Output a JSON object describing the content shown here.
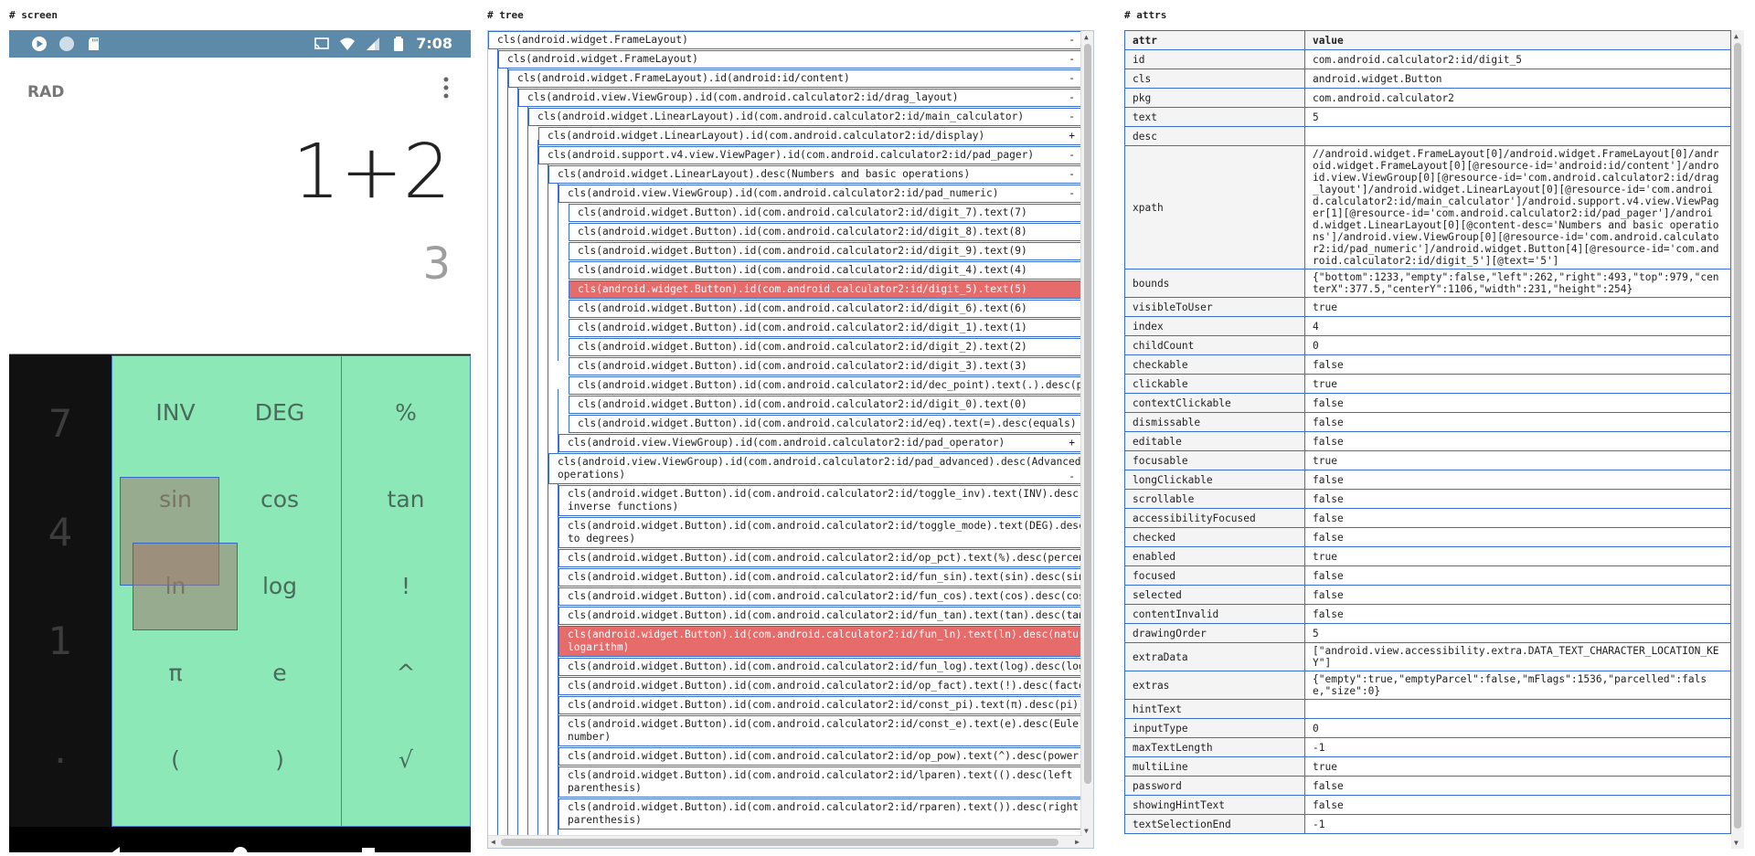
{
  "sections": {
    "screen": "# screen",
    "tree": "# tree",
    "attrs": "# attrs"
  },
  "phone": {
    "status": {
      "time": "7:08"
    },
    "display": {
      "mode": "RAD",
      "formula": "1+2",
      "result": "3"
    },
    "numeric_keys": [
      "7",
      "4",
      "1",
      "."
    ],
    "advanced_keys": [
      "INV",
      "DEG",
      "%",
      "sin",
      "cos",
      "tan",
      "ln",
      "log",
      "!",
      "π",
      "e",
      "^",
      "(",
      ")",
      "√"
    ],
    "colors": {
      "status_bar": "#5d8aa8",
      "advanced_pad": "#8de8b7",
      "numeric_pad": "#111111",
      "highlight": "#e66b6b"
    }
  },
  "tree": {
    "rows": [
      {
        "text": "cls(android.widget.FrameLayout)",
        "toggle": "-"
      },
      {
        "text": "cls(android.widget.FrameLayout)",
        "toggle": "-"
      },
      {
        "text": "cls(android.widget.FrameLayout).id(android:id/content)",
        "toggle": "-"
      },
      {
        "text": "cls(android.view.ViewGroup).id(com.android.calculator2:id/drag_layout)",
        "toggle": "-"
      },
      {
        "text": "cls(android.widget.LinearLayout).id(com.android.calculator2:id/main_calculator)",
        "toggle": "-"
      },
      {
        "text": "cls(android.widget.LinearLayout).id(com.android.calculator2:id/display)",
        "toggle": "+"
      },
      {
        "text": "cls(android.support.v4.view.ViewPager).id(com.android.calculator2:id/pad_pager)",
        "toggle": "-"
      },
      {
        "text": "cls(android.widget.LinearLayout).desc(Numbers and basic operations)",
        "toggle": "-"
      },
      {
        "text": "cls(android.view.ViewGroup).id(com.android.calculator2:id/pad_numeric)",
        "toggle": "-"
      },
      {
        "text": "cls(android.widget.Button).id(com.android.calculator2:id/digit_7).text(7)",
        "toggle": ""
      },
      {
        "text": "cls(android.widget.Button).id(com.android.calculator2:id/digit_8).text(8)",
        "toggle": ""
      },
      {
        "text": "cls(android.widget.Button).id(com.android.calculator2:id/digit_9).text(9)",
        "toggle": ""
      },
      {
        "text": "cls(android.widget.Button).id(com.android.calculator2:id/digit_4).text(4)",
        "toggle": ""
      },
      {
        "text": "cls(android.widget.Button).id(com.android.calculator2:id/digit_5).text(5)",
        "toggle": ""
      },
      {
        "text": "cls(android.widget.Button).id(com.android.calculator2:id/digit_6).text(6)",
        "toggle": ""
      },
      {
        "text": "cls(android.widget.Button).id(com.android.calculator2:id/digit_1).text(1)",
        "toggle": ""
      },
      {
        "text": "cls(android.widget.Button).id(com.android.calculator2:id/digit_2).text(2)",
        "toggle": ""
      },
      {
        "text": "cls(android.widget.Button).id(com.android.calculator2:id/digit_3).text(3)",
        "toggle": ""
      },
      {
        "text": "cls(android.widget.Button).id(com.android.calculator2:id/dec_point).text(.).desc(point)",
        "toggle": ""
      },
      {
        "text": "cls(android.widget.Button).id(com.android.calculator2:id/digit_0).text(0)",
        "toggle": ""
      },
      {
        "text": "cls(android.widget.Button).id(com.android.calculator2:id/eq).text(=).desc(equals)",
        "toggle": ""
      },
      {
        "text": "cls(android.view.ViewGroup).id(com.android.calculator2:id/pad_operator)",
        "toggle": "+"
      },
      {
        "text": "cls(android.view.ViewGroup).id(com.android.calculator2:id/pad_advanced).desc(Advanced operations)",
        "toggle": "-"
      },
      {
        "text": "cls(android.widget.Button).id(com.android.calculator2:id/toggle_inv).text(INV).desc(show inverse functions)",
        "toggle": ""
      },
      {
        "text": "cls(android.widget.Button).id(com.android.calculator2:id/toggle_mode).text(DEG).desc(switch to degrees)",
        "toggle": ""
      },
      {
        "text": "cls(android.widget.Button).id(com.android.calculator2:id/op_pct).text(%).desc(percent)",
        "toggle": ""
      },
      {
        "text": "cls(android.widget.Button).id(com.android.calculator2:id/fun_sin).text(sin).desc(sine)",
        "toggle": ""
      },
      {
        "text": "cls(android.widget.Button).id(com.android.calculator2:id/fun_cos).text(cos).desc(cosine)",
        "toggle": ""
      },
      {
        "text": "cls(android.widget.Button).id(com.android.calculator2:id/fun_tan).text(tan).desc(tangent)",
        "toggle": ""
      },
      {
        "text": "cls(android.widget.Button).id(com.android.calculator2:id/fun_ln).text(ln).desc(natural logarithm)",
        "toggle": ""
      },
      {
        "text": "cls(android.widget.Button).id(com.android.calculator2:id/fun_log).text(log).desc(logarithm)",
        "toggle": ""
      },
      {
        "text": "cls(android.widget.Button).id(com.android.calculator2:id/op_fact).text(!).desc(factorial)",
        "toggle": ""
      },
      {
        "text": "cls(android.widget.Button).id(com.android.calculator2:id/const_pi).text(π).desc(pi)",
        "toggle": ""
      },
      {
        "text": "cls(android.widget.Button).id(com.android.calculator2:id/const_e).text(e).desc(Euler's number)",
        "toggle": ""
      },
      {
        "text": "cls(android.widget.Button).id(com.android.calculator2:id/op_pow).text(^).desc(power)",
        "toggle": ""
      },
      {
        "text": "cls(android.widget.Button).id(com.android.calculator2:id/lparen).text(().desc(left parenthesis)",
        "toggle": ""
      },
      {
        "text": "cls(android.widget.Button).id(com.android.calculator2:id/rparen).text()).desc(right parenthesis)",
        "toggle": ""
      }
    ]
  },
  "attrs": {
    "header": [
      "attr",
      "value"
    ],
    "rows": [
      [
        "id",
        "com.android.calculator2:id/digit_5"
      ],
      [
        "cls",
        "android.widget.Button"
      ],
      [
        "pkg",
        "com.android.calculator2"
      ],
      [
        "text",
        "5"
      ],
      [
        "desc",
        ""
      ],
      [
        "xpath",
        "//android.widget.FrameLayout[0]/android.widget.FrameLayout[0]/android.widget.FrameLayout[0][@resource-id='android:id/content']/android.view.ViewGroup[0][@resource-id='com.android.calculator2:id/drag_layout']/android.widget.LinearLayout[0][@resource-id='com.android.calculator2:id/main_calculator']/android.support.v4.view.ViewPager[1][@resource-id='com.android.calculator2:id/pad_pager']/android.widget.LinearLayout[0][@content-desc='Numbers and basic operations']/android.view.ViewGroup[0][@resource-id='com.android.calculator2:id/pad_numeric']/android.widget.Button[4][@resource-id='com.android.calculator2:id/digit_5'][@text='5']"
      ],
      [
        "bounds",
        "{\"bottom\":1233,\"empty\":false,\"left\":262,\"right\":493,\"top\":979,\"centerX\":377.5,\"centerY\":1106,\"width\":231,\"height\":254}"
      ],
      [
        "visibleToUser",
        "true"
      ],
      [
        "index",
        "4"
      ],
      [
        "childCount",
        "0"
      ],
      [
        "checkable",
        "false"
      ],
      [
        "clickable",
        "true"
      ],
      [
        "contextClickable",
        "false"
      ],
      [
        "dismissable",
        "false"
      ],
      [
        "editable",
        "false"
      ],
      [
        "focusable",
        "true"
      ],
      [
        "longClickable",
        "false"
      ],
      [
        "scrollable",
        "false"
      ],
      [
        "accessibilityFocused",
        "false"
      ],
      [
        "checked",
        "false"
      ],
      [
        "enabled",
        "true"
      ],
      [
        "focused",
        "false"
      ],
      [
        "selected",
        "false"
      ],
      [
        "contentInvalid",
        "false"
      ],
      [
        "drawingOrder",
        "5"
      ],
      [
        "extraData",
        "[\"android.view.accessibility.extra.DATA_TEXT_CHARACTER_LOCATION_KEY\"]"
      ],
      [
        "extras",
        "{\"empty\":true,\"emptyParcel\":false,\"mFlags\":1536,\"parcelled\":false,\"size\":0}"
      ],
      [
        "hintText",
        ""
      ],
      [
        "inputType",
        "0"
      ],
      [
        "maxTextLength",
        "-1"
      ],
      [
        "multiLine",
        "true"
      ],
      [
        "password",
        "false"
      ],
      [
        "showingHintText",
        "false"
      ],
      [
        "textSelectionEnd",
        "-1"
      ]
    ]
  }
}
